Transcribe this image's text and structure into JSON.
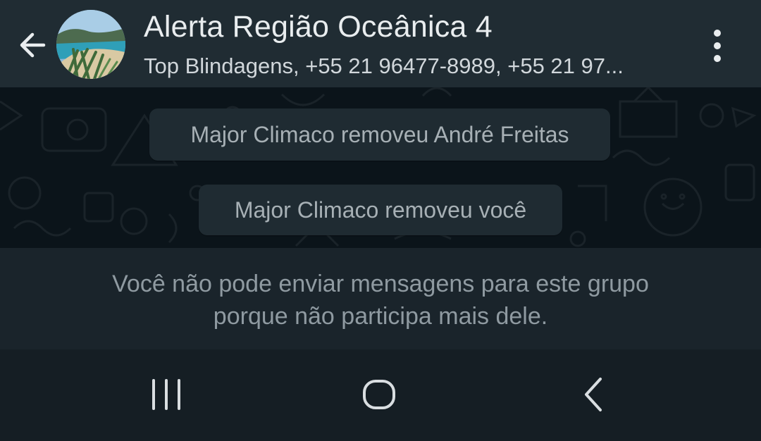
{
  "header": {
    "title": "Alerta Região Oceânica 4",
    "subtitle": "Top Blindagens, +55 21 96477-8989, +55 21 97...",
    "back_icon": "arrow-left-icon",
    "menu_icon": "more-vertical-icon",
    "avatar": "group-avatar-beach-photo"
  },
  "chat": {
    "system_messages": [
      "Major Climaco removeu André Freitas",
      "Major Climaco removeu você"
    ]
  },
  "notice": {
    "line1": "Você não pode enviar mensagens para este grupo",
    "line2": "porque não participa mais dele."
  },
  "navbar": {
    "recents_icon": "recents-icon",
    "home_icon": "home-icon",
    "back_icon": "nav-back-icon"
  },
  "colors": {
    "header_bg": "#202c33",
    "chat_bg": "#0b141a",
    "bubble_bg": "#1f2b32",
    "notice_bg": "#1a242b",
    "navbar_bg": "#151e24",
    "title_text": "#e9edef",
    "muted_text": "#8f9aa1"
  }
}
